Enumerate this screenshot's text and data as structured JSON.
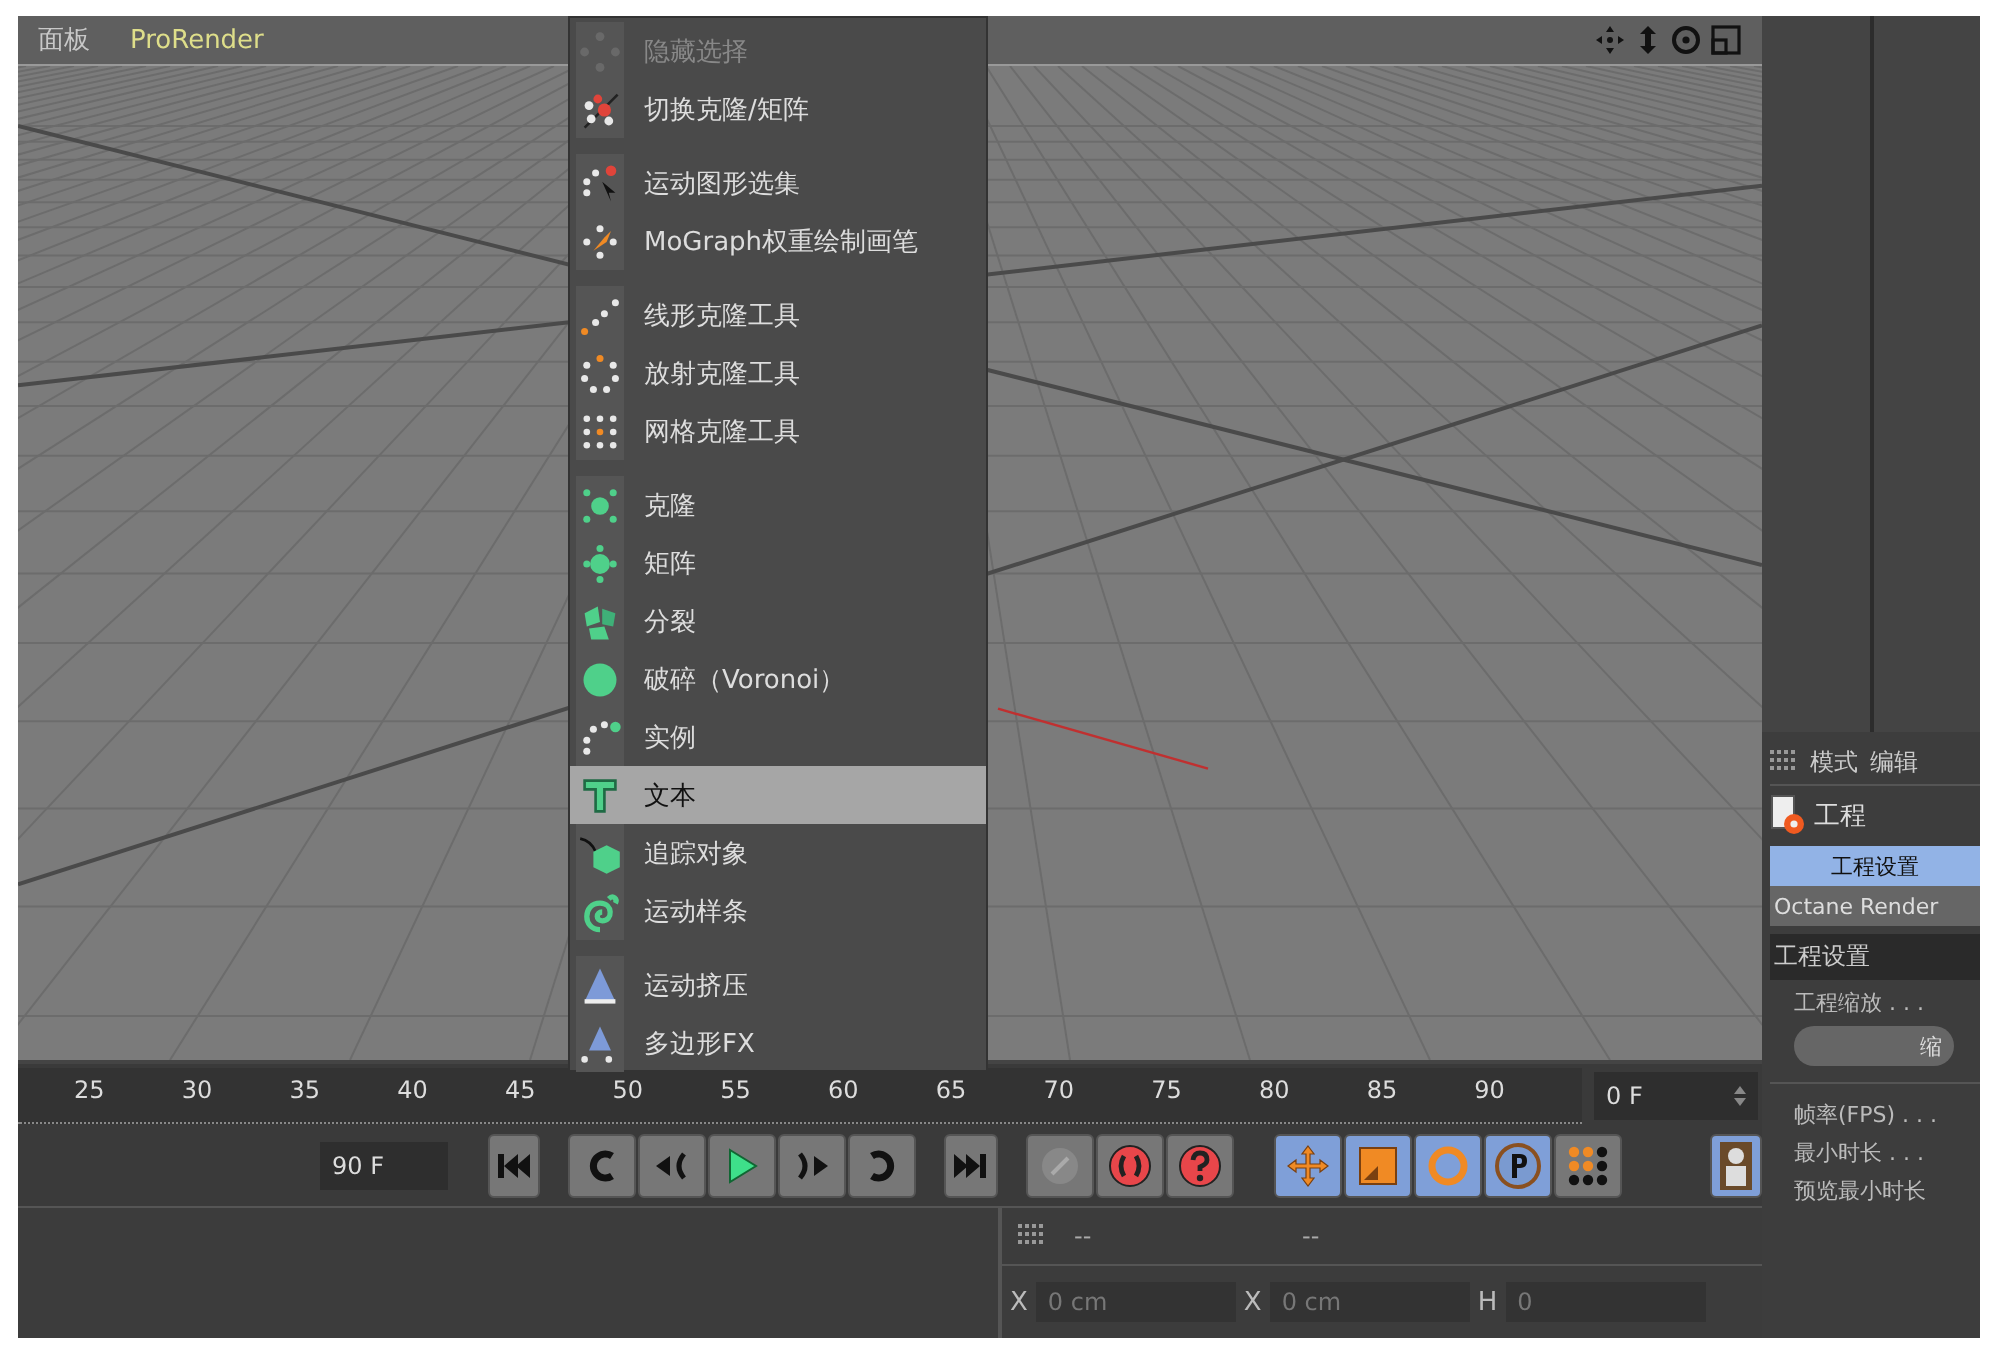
{
  "viewport": {
    "menu": [
      {
        "label": "面板",
        "highlighted": false
      },
      {
        "label": "ProRender",
        "highlighted": true
      }
    ]
  },
  "popup_menu": {
    "groups": [
      [
        {
          "label": "隐藏选择",
          "disabled": true,
          "selected": false
        },
        {
          "label": "切换克隆/矩阵",
          "disabled": false,
          "selected": false
        }
      ],
      [
        {
          "label": "运动图形选集",
          "disabled": false,
          "selected": false
        },
        {
          "label": "MoGraph权重绘制画笔",
          "disabled": false,
          "selected": false
        }
      ],
      [
        {
          "label": "线形克隆工具",
          "disabled": false,
          "selected": false
        },
        {
          "label": "放射克隆工具",
          "disabled": false,
          "selected": false
        },
        {
          "label": "网格克隆工具",
          "disabled": false,
          "selected": false
        }
      ],
      [
        {
          "label": "克隆",
          "disabled": false,
          "selected": false
        },
        {
          "label": "矩阵",
          "disabled": false,
          "selected": false
        },
        {
          "label": "分裂",
          "disabled": false,
          "selected": false
        },
        {
          "label": "破碎（Voronoi）",
          "disabled": false,
          "selected": false
        },
        {
          "label": "实例",
          "disabled": false,
          "selected": false
        },
        {
          "label": "文本",
          "disabled": false,
          "selected": true
        },
        {
          "label": "追踪对象",
          "disabled": false,
          "selected": false
        },
        {
          "label": "运动样条",
          "disabled": false,
          "selected": false
        }
      ],
      [
        {
          "label": "运动挤压",
          "disabled": false,
          "selected": false
        },
        {
          "label": "多边形FX",
          "disabled": false,
          "selected": false
        }
      ]
    ]
  },
  "timeline": {
    "ticks": [
      "25",
      "30",
      "35",
      "40",
      "45",
      "50",
      "55",
      "60",
      "65",
      "70",
      "75",
      "80",
      "85",
      "90"
    ],
    "current_frame": "0 F",
    "end_frame": "90 F"
  },
  "mode_tools": [
    {
      "selected": true
    },
    {
      "selected": true
    },
    {
      "selected": true
    },
    {
      "selected": true
    },
    {
      "selected": false
    }
  ],
  "attributes": {
    "menu": [
      "模式",
      "编辑"
    ],
    "title": "工程",
    "tabs": [
      {
        "label": "工程设置",
        "selected": true
      },
      {
        "label": "Octane Render",
        "selected": false
      }
    ],
    "section": "工程设置",
    "scale_label": "工程缩放 . . .",
    "scale_button": "缩",
    "fields": [
      "帧率(FPS) . . .",
      "最小时长 . . .",
      "预览最小时长"
    ]
  },
  "coordinates": {
    "columns": [
      "--",
      "--"
    ],
    "fields": [
      {
        "axis": "X",
        "value": "0 cm"
      },
      {
        "axis": "X",
        "value": "0 cm"
      },
      {
        "axis": "H",
        "value": "0"
      }
    ]
  }
}
